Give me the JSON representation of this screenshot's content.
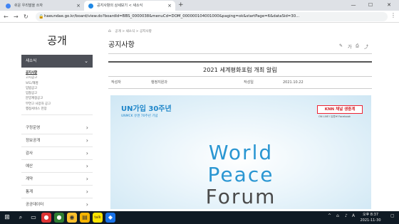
{
  "browser": {
    "tabs": [
      {
        "title": "쉬운 우리말을 쓰자",
        "color": "#4285f4"
      },
      {
        "title": "공지사항의 상세보기 < 새소식",
        "color": "#1e88e5"
      }
    ],
    "new_tab": "+",
    "url": "haeundae.go.kr/board/view.do?boardId=BBS_0000038&menuCd=DOM_000000104001000&paging=ok&startPage=6&dataSid=30...",
    "controls": {
      "minimize": "—",
      "maximize": "☐",
      "close": "✕"
    }
  },
  "sidebar": {
    "title": "공개",
    "section": "새소식",
    "sub_items": [
      "공지사항",
      "고시공고",
      "보도/해명",
      "입법공고",
      "입찰공고",
      "분양계정공고",
      "무연고 사망자 공고",
      "행정서비스 헌장"
    ],
    "menu": [
      "구정운영",
      "정보공개",
      "감사",
      "예산",
      "계약",
      "통계",
      "공공데이터"
    ]
  },
  "main": {
    "breadcrumb": "공개 > 새소식 > 공지사항",
    "page_title": "공지사항",
    "tools": {
      "edit": "✎",
      "text_size": "가",
      "print": "⎙",
      "share": "⤴"
    },
    "post": {
      "title": "2021 세계평화포럼 개최 알림",
      "author_label": "작성자",
      "author": "행정지원과",
      "date_label": "작성일",
      "date": "2021.10.22"
    },
    "poster": {
      "un_title": "UN가입 30주년",
      "un_sub": "UNMCK 유엔 70주년 기념",
      "broadcaster": "KNN 채널 생중계",
      "broadcaster_sub": "ON LIVE! 유튜브  Facebook",
      "line1": "World",
      "line2": "Peace",
      "line3": "Forum"
    }
  },
  "taskbar": {
    "time": "오후 8:37",
    "date": "2021-11-30",
    "ime": "A"
  }
}
